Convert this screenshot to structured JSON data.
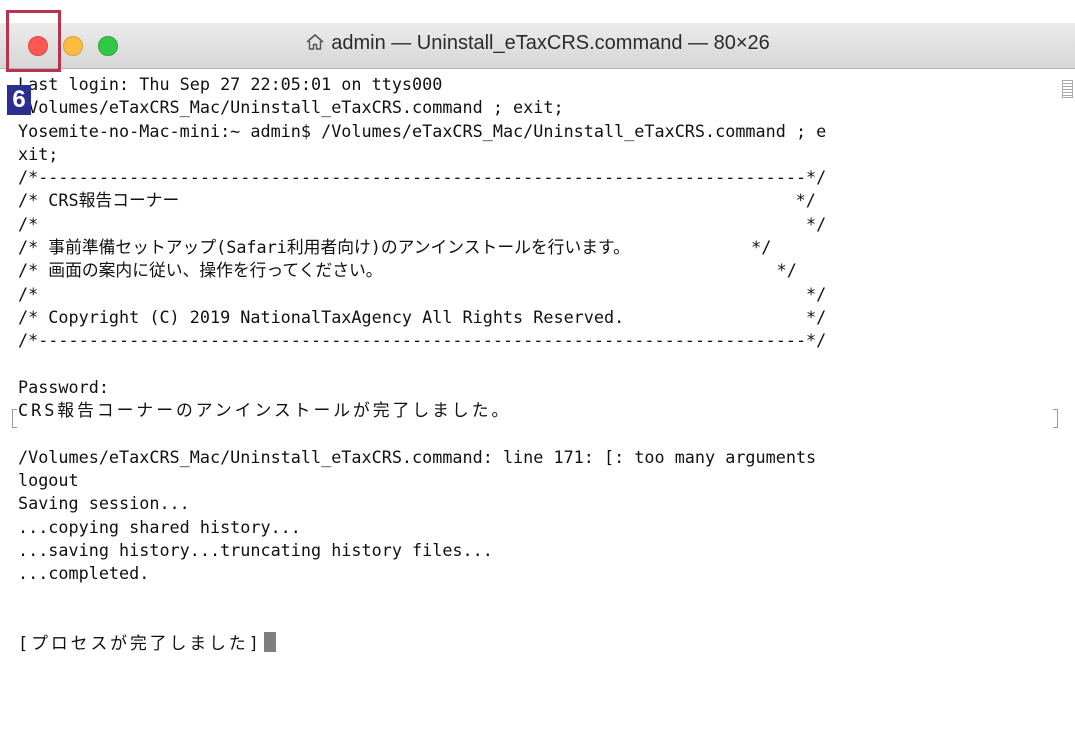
{
  "window": {
    "title": "admin — Uninstall_eTaxCRS.command — 80×26",
    "title_icon": "home-icon"
  },
  "annotation": {
    "step_number": "6",
    "highlight_color": "#b5344e",
    "badge_color": "#2b2f8f"
  },
  "colors": {
    "close": "#fc5753",
    "minimize": "#fdbc40",
    "zoom": "#33c748"
  },
  "terminal": {
    "lines": [
      "Last login: Thu Sep 27 22:05:01 on ttys000",
      "/Volumes/eTaxCRS_Mac/Uninstall_eTaxCRS.command ; exit;",
      "Yosemite-no-Mac-mini:~ admin$ /Volumes/eTaxCRS_Mac/Uninstall_eTaxCRS.command ; e",
      "xit;",
      "/*----------------------------------------------------------------------------*/",
      "/* CRS報告コーナー                                                             */",
      "/*                                                                            */",
      "/* 事前準備セットアップ(Safari利用者向け)のアンインストールを行います。            */",
      "/* 画面の案内に従い、操作を行ってください。                                       */",
      "/*                                                                            */",
      "/* Copyright (C) 2019 NationalTaxAgency All Rights Reserved.                  */",
      "/*----------------------------------------------------------------------------*/",
      "",
      "Password:",
      "CRS報告コーナーのアンインストールが完了しました。",
      "",
      "/Volumes/eTaxCRS_Mac/Uninstall_eTaxCRS.command: line 171: [: too many arguments",
      "logout",
      "Saving session...",
      "...copying shared history...",
      "...saving history...truncating history files...",
      "...completed.",
      "",
      "",
      "[プロセスが完了しました]"
    ]
  }
}
